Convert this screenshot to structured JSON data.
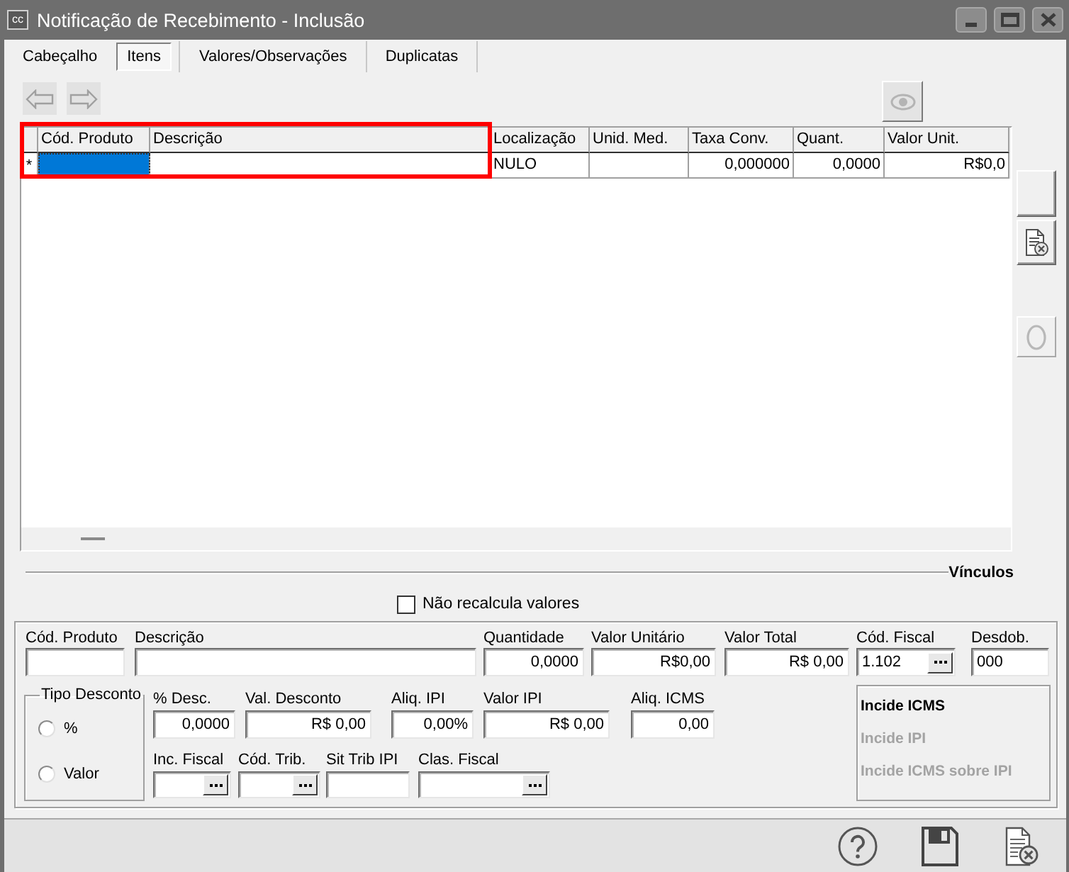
{
  "window": {
    "icon_label": "cc",
    "title": "Notificação de Recebimento - Inclusão"
  },
  "tabs": [
    {
      "label": "Cabeçalho",
      "selected": false
    },
    {
      "label": "Itens",
      "selected": true
    },
    {
      "label": "Valores/Observações",
      "selected": false
    },
    {
      "label": "Duplicatas",
      "selected": false
    }
  ],
  "nav_buttons": [
    {
      "kind": "back",
      "disabled": true
    },
    {
      "kind": "forward",
      "disabled": true
    }
  ],
  "view_button": {
    "disabled": true
  },
  "table": {
    "columns": [
      {
        "label": "Cód. Produto",
        "kind": "text",
        "highlighted": true
      },
      {
        "label": "Descrição",
        "kind": "text",
        "highlighted": true
      },
      {
        "label": "Localização",
        "kind": "text",
        "highlighted": false
      },
      {
        "label": "Unid. Med.",
        "kind": "text",
        "highlighted": false
      },
      {
        "label": "Taxa Conv.",
        "kind": "number",
        "highlighted": false
      },
      {
        "label": "Quant.",
        "kind": "number",
        "highlighted": false
      },
      {
        "label": "Valor Unit.",
        "kind": "number",
        "highlighted": false
      }
    ],
    "rows": [
      {
        "marker": "*",
        "cells": [
          {
            "selected": true
          },
          {
            "selected": false
          },
          {
            "text": "NULO",
            "selected": false
          },
          {
            "selected": false
          },
          {
            "text": "0,000000",
            "selected": false
          },
          {
            "text": "0,0000",
            "selected": false
          },
          {
            "text": "R$0,0",
            "selected": false
          }
        ]
      }
    ]
  },
  "side_buttons": [
    {
      "kind": "blank",
      "disabled": false
    },
    {
      "kind": "remove",
      "disabled": false
    },
    {
      "kind": "circle",
      "disabled": true
    }
  ],
  "links_section": {
    "title": "Vínculos"
  },
  "recalc_option": {
    "label": "Não recalcula valores",
    "checked": false
  },
  "item_form": {
    "field_rows": [
      {
        "fields": [
          {
            "label": "Cód. Produto",
            "kind": "text"
          },
          {
            "label": "Descrição",
            "kind": "text"
          },
          {
            "label": "Quantidade",
            "kind": "number",
            "value": "0,0000"
          },
          {
            "label": "Valor Unitário",
            "kind": "number",
            "value": "R$0,00"
          },
          {
            "label": "Valor Total",
            "kind": "number",
            "value": "R$ 0,00"
          },
          {
            "label": "Cód. Fiscal",
            "kind": "lookup",
            "value": "1.102"
          },
          {
            "label": "Desdob.",
            "kind": "text",
            "value": "000"
          }
        ]
      },
      {
        "fields": [
          {
            "label": "% Desc.",
            "kind": "number",
            "value": "0,0000"
          },
          {
            "label": "Val. Desconto",
            "kind": "number",
            "value": "R$ 0,00"
          },
          {
            "label": "Aliq. IPI",
            "kind": "number",
            "value": "0,00%"
          },
          {
            "label": "Valor IPI",
            "kind": "number",
            "value": "R$ 0,00"
          },
          {
            "label": "Aliq. ICMS",
            "kind": "number",
            "value": "0,00"
          }
        ]
      },
      {
        "fields": [
          {
            "label": "Inc. Fiscal",
            "kind": "lookup"
          },
          {
            "label": "Cód. Trib.",
            "kind": "lookup"
          },
          {
            "label": "Sit Trib IPI",
            "kind": "text"
          },
          {
            "label": "Clas. Fiscal",
            "kind": "lookup"
          }
        ]
      }
    ],
    "discount_type": {
      "title": "Tipo Desconto",
      "options": [
        {
          "label": "%",
          "selected": false
        },
        {
          "label": "Valor",
          "selected": false
        }
      ]
    },
    "tax_flags": [
      {
        "label": "Incide ICMS",
        "disabled": false
      },
      {
        "label": "Incide IPI",
        "disabled": true
      },
      {
        "label": "Incide ICMS sobre IPI",
        "disabled": true
      }
    ]
  },
  "footer_buttons": [
    {
      "kind": "help"
    },
    {
      "kind": "save"
    },
    {
      "kind": "cancel"
    }
  ]
}
